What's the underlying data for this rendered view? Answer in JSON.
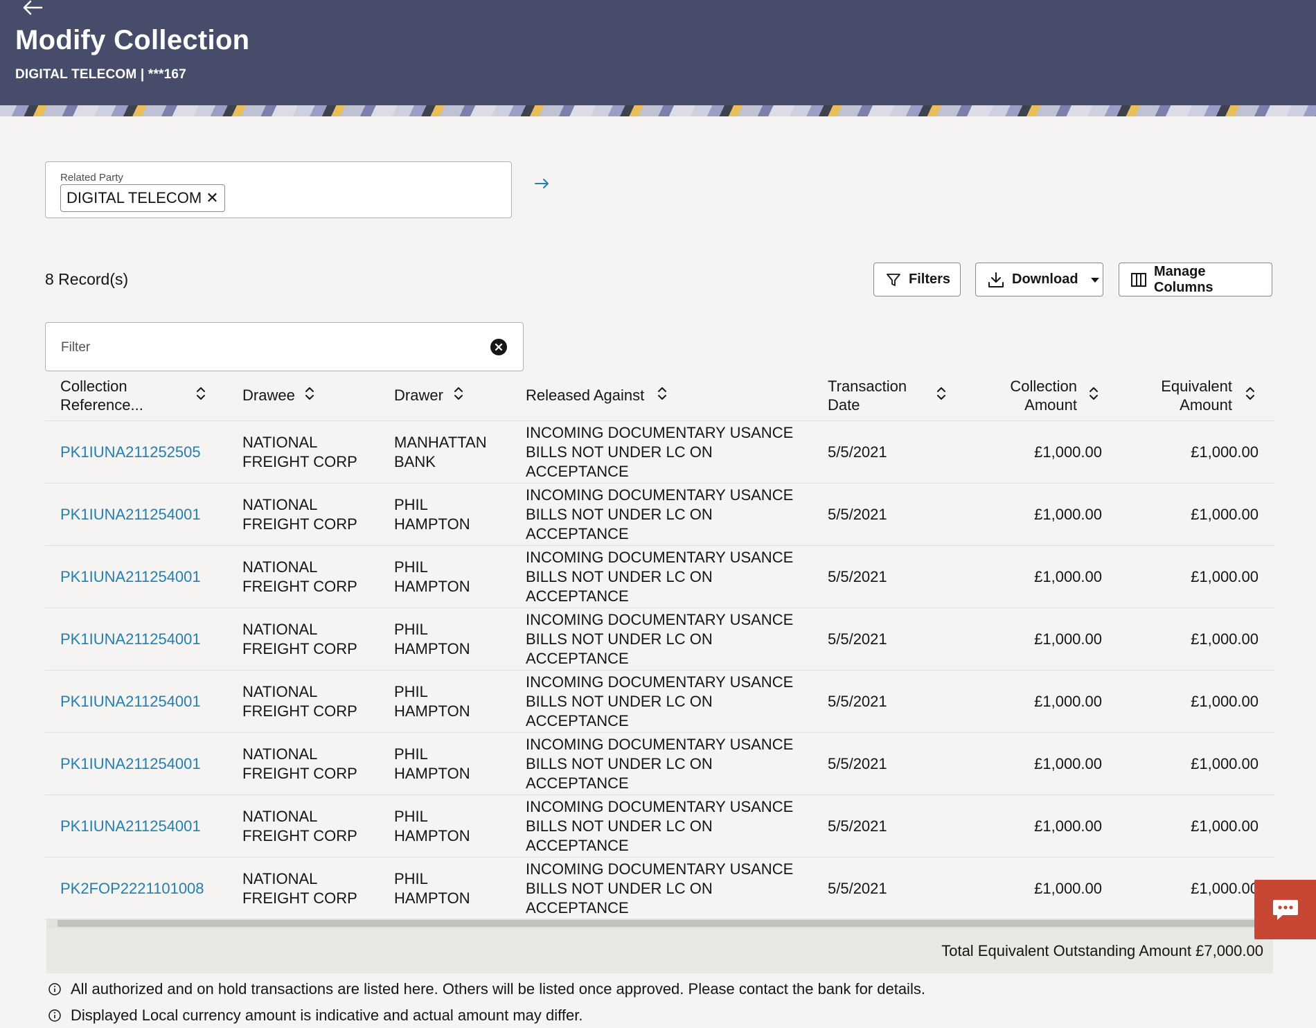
{
  "header": {
    "title": "Modify Collection",
    "subtitle": "DIGITAL TELECOM | ***167"
  },
  "related_party": {
    "label": "Related Party",
    "chip": "DIGITAL TELECOM",
    "chip_remove": "✕"
  },
  "toolbar": {
    "record_count": "8 Record(s)",
    "filters_label": "Filters",
    "download_label": "Download",
    "manage_columns_label": "Manage Columns"
  },
  "filter": {
    "placeholder": "Filter"
  },
  "table": {
    "headers": {
      "collection_reference": "Collection Reference...",
      "drawee": "Drawee",
      "drawer": "Drawer",
      "released_against": "Released Against",
      "transaction_date": "Transaction Date",
      "collection_amount": "Collection Amount",
      "equivalent_amount": "Equivalent Amount"
    },
    "rows": [
      {
        "ref": "PK1IUNA211252505",
        "drawee": "NATIONAL FREIGHT CORP",
        "drawer": "MANHATTAN BANK",
        "released": "INCOMING DOCUMENTARY USANCE BILLS NOT UNDER LC ON ACCEPTANCE",
        "date": "5/5/2021",
        "amount": "£1,000.00",
        "equivalent": "£1,000.00"
      },
      {
        "ref": "PK1IUNA211254001",
        "drawee": "NATIONAL FREIGHT CORP",
        "drawer": "PHIL HAMPTON",
        "released": "INCOMING DOCUMENTARY USANCE BILLS NOT UNDER LC ON ACCEPTANCE",
        "date": "5/5/2021",
        "amount": "£1,000.00",
        "equivalent": "£1,000.00"
      },
      {
        "ref": "PK1IUNA211254001",
        "drawee": "NATIONAL FREIGHT CORP",
        "drawer": "PHIL HAMPTON",
        "released": "INCOMING DOCUMENTARY USANCE BILLS NOT UNDER LC ON ACCEPTANCE",
        "date": "5/5/2021",
        "amount": "£1,000.00",
        "equivalent": "£1,000.00"
      },
      {
        "ref": "PK1IUNA211254001",
        "drawee": "NATIONAL FREIGHT CORP",
        "drawer": "PHIL HAMPTON",
        "released": "INCOMING DOCUMENTARY USANCE BILLS NOT UNDER LC ON ACCEPTANCE",
        "date": "5/5/2021",
        "amount": "£1,000.00",
        "equivalent": "£1,000.00"
      },
      {
        "ref": "PK1IUNA211254001",
        "drawee": "NATIONAL FREIGHT CORP",
        "drawer": "PHIL HAMPTON",
        "released": "INCOMING DOCUMENTARY USANCE BILLS NOT UNDER LC ON ACCEPTANCE",
        "date": "5/5/2021",
        "amount": "£1,000.00",
        "equivalent": "£1,000.00"
      },
      {
        "ref": "PK1IUNA211254001",
        "drawee": "NATIONAL FREIGHT CORP",
        "drawer": "PHIL HAMPTON",
        "released": "INCOMING DOCUMENTARY USANCE BILLS NOT UNDER LC ON ACCEPTANCE",
        "date": "5/5/2021",
        "amount": "£1,000.00",
        "equivalent": "£1,000.00"
      },
      {
        "ref": "PK1IUNA211254001",
        "drawee": "NATIONAL FREIGHT CORP",
        "drawer": "PHIL HAMPTON",
        "released": "INCOMING DOCUMENTARY USANCE BILLS NOT UNDER LC ON ACCEPTANCE",
        "date": "5/5/2021",
        "amount": "£1,000.00",
        "equivalent": "£1,000.00"
      },
      {
        "ref": "PK2FOP2221101008",
        "drawee": "NATIONAL FREIGHT CORP",
        "drawer": "PHIL HAMPTON",
        "released": "INCOMING DOCUMENTARY USANCE BILLS NOT UNDER LC ON ACCEPTANCE",
        "date": "5/5/2021",
        "amount": "£1,000.00",
        "equivalent": "£1,000.00"
      }
    ],
    "total_label": "Total Equivalent Outstanding Amount £7,000.00"
  },
  "notes": [
    "All authorized and on hold transactions are listed here. Others will be listed once approved. Please contact the bank for details.",
    "Displayed Local currency amount is indicative and actual amount may differ."
  ],
  "colors": {
    "header_bg": "#474c6a",
    "link": "#227fb1",
    "chat_button": "#c74634"
  },
  "icons": [
    "back-arrow-icon",
    "arrow-right-icon",
    "filter-funnel-icon",
    "download-icon",
    "caret-down-icon",
    "columns-icon",
    "clear-icon",
    "sort-icon",
    "info-icon",
    "chat-icon"
  ]
}
